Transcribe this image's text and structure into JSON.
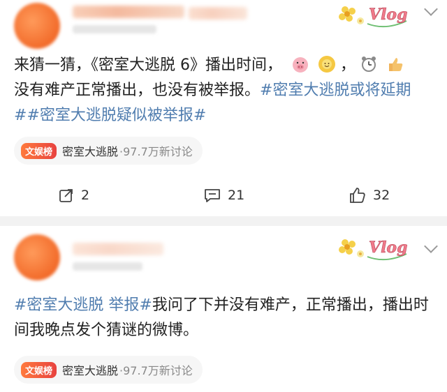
{
  "posts": [
    {
      "text": {
        "part1": "来猜一猜，《密室大逃脱 6》播出时间，",
        "part2": "，",
        "part3": "没有难产正常播出，也没有被举报。",
        "topic1": "#密室大逃脱或将延期#",
        "topic2": "#密室大逃脱疑似被举报#"
      },
      "emojis": [
        "pig-face-emoji",
        "sunflower-emoji",
        "alarm-clock-emoji",
        "thumbs-up-emoji"
      ],
      "hot_tag": "文娱榜",
      "hot_topic": "密室大逃脱",
      "hot_count": "·97.7万新讨论",
      "actions": {
        "share": "2",
        "comment": "21",
        "like": "32"
      },
      "badge_text": "Vlog"
    },
    {
      "text": {
        "topic1": "#密室大逃脱 举报#",
        "part1": "我问了下并没有难产，正常播出，播出时间我晚点发个猜谜的微博。"
      },
      "hot_tag": "文娱榜",
      "hot_topic": "密室大逃脱",
      "hot_count": "·97.7万新讨论",
      "badge_text": "Vlog"
    }
  ],
  "colors": {
    "topic": "#507daf",
    "avatar": "#f26b2a",
    "hot_tag": "#e8423f"
  }
}
